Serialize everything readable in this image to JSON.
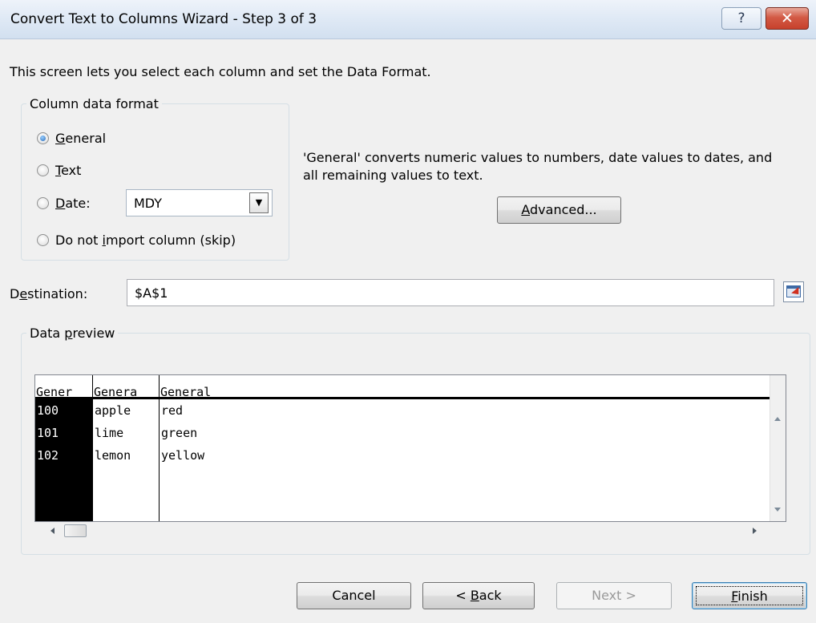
{
  "window": {
    "title": "Convert Text to Columns Wizard - Step 3 of 3",
    "help_label": "?",
    "close_label": "✕"
  },
  "intro": "This screen lets you select each column and set the Data Format.",
  "column_format": {
    "legend": "Column data format",
    "selected": "General",
    "options": [
      {
        "pre": "",
        "key": "G",
        "post": "eneral"
      },
      {
        "pre": "",
        "key": "T",
        "post": "ext"
      },
      {
        "pre": "",
        "key": "D",
        "post": "ate:"
      },
      {
        "pre": "Do not ",
        "key": "i",
        "post": "mport column (skip)"
      }
    ],
    "date_format": "MDY"
  },
  "description": "'General' converts numeric values to numbers, date values to dates, and all remaining values to text.",
  "advanced_button": {
    "pre": "",
    "key": "A",
    "post": "dvanced..."
  },
  "destination": {
    "label_pre": "D",
    "label_key": "e",
    "label_post": "stination:",
    "value": "$A$1"
  },
  "preview": {
    "legend_pre": "Data ",
    "legend_key": "p",
    "legend_post": "review",
    "headers": [
      "Gener",
      "Genera",
      "General"
    ],
    "rows": [
      [
        "100",
        "apple",
        "red"
      ],
      [
        "101",
        "lime",
        "green"
      ],
      [
        "102",
        "lemon",
        "yellow"
      ]
    ]
  },
  "buttons": {
    "cancel": "Cancel",
    "back_pre": "< ",
    "back_key": "B",
    "back_post": "ack",
    "next": "Next >",
    "finish_key": "F",
    "finish_post": "inish"
  }
}
